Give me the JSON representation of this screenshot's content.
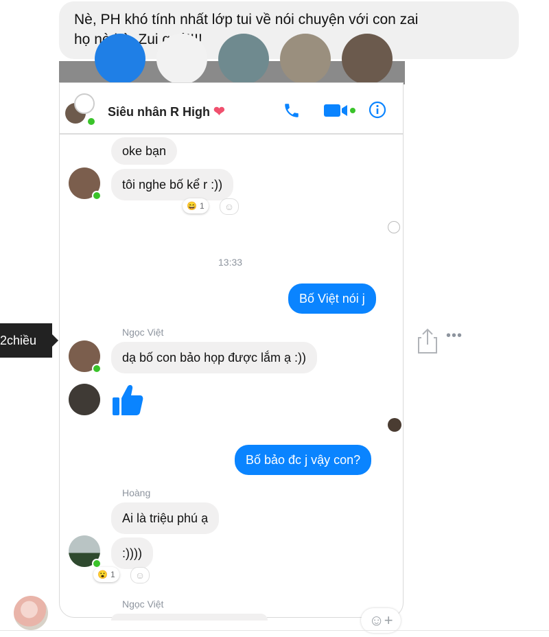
{
  "outer_message": {
    "line1": "Nè, PH khó tính nhất lớp tui về nói chuyện với con zai",
    "line2": "họ nè bà. Zui quá!!!!"
  },
  "tooltip": {
    "label": "2chiều"
  },
  "chat": {
    "header": {
      "name": "Siêu nhân R High",
      "heart": "❤"
    },
    "messages": {
      "m1": "oke bạn",
      "m2": "tôi nghe bố kể r :))",
      "m2_reaction_emoji": "😄",
      "m2_reaction_count": "1",
      "timestamp": "13:33",
      "m3": "Bố Việt nói j",
      "sender1": "Ngọc Việt",
      "m4": "dạ bố con bảo họp được lắm ạ :))",
      "m5_like": "👍",
      "m6": "Bố bảo đc j vậy con?",
      "sender2": "Hoàng",
      "m7": "Ai là triệu phú ạ",
      "m8": ":))))",
      "m8_reaction_emoji": "😮",
      "m8_reaction_count": "1",
      "sender3": "Ngọc Việt"
    }
  },
  "icons": {
    "phone": "phone-icon",
    "video": "video-icon",
    "info": "info-icon",
    "share": "share-icon",
    "more": "more-icon",
    "emoji": "emoji-add-icon"
  },
  "colors": {
    "accent": "#0a84ff",
    "online": "#3ac32a",
    "heart": "#f0506e"
  }
}
